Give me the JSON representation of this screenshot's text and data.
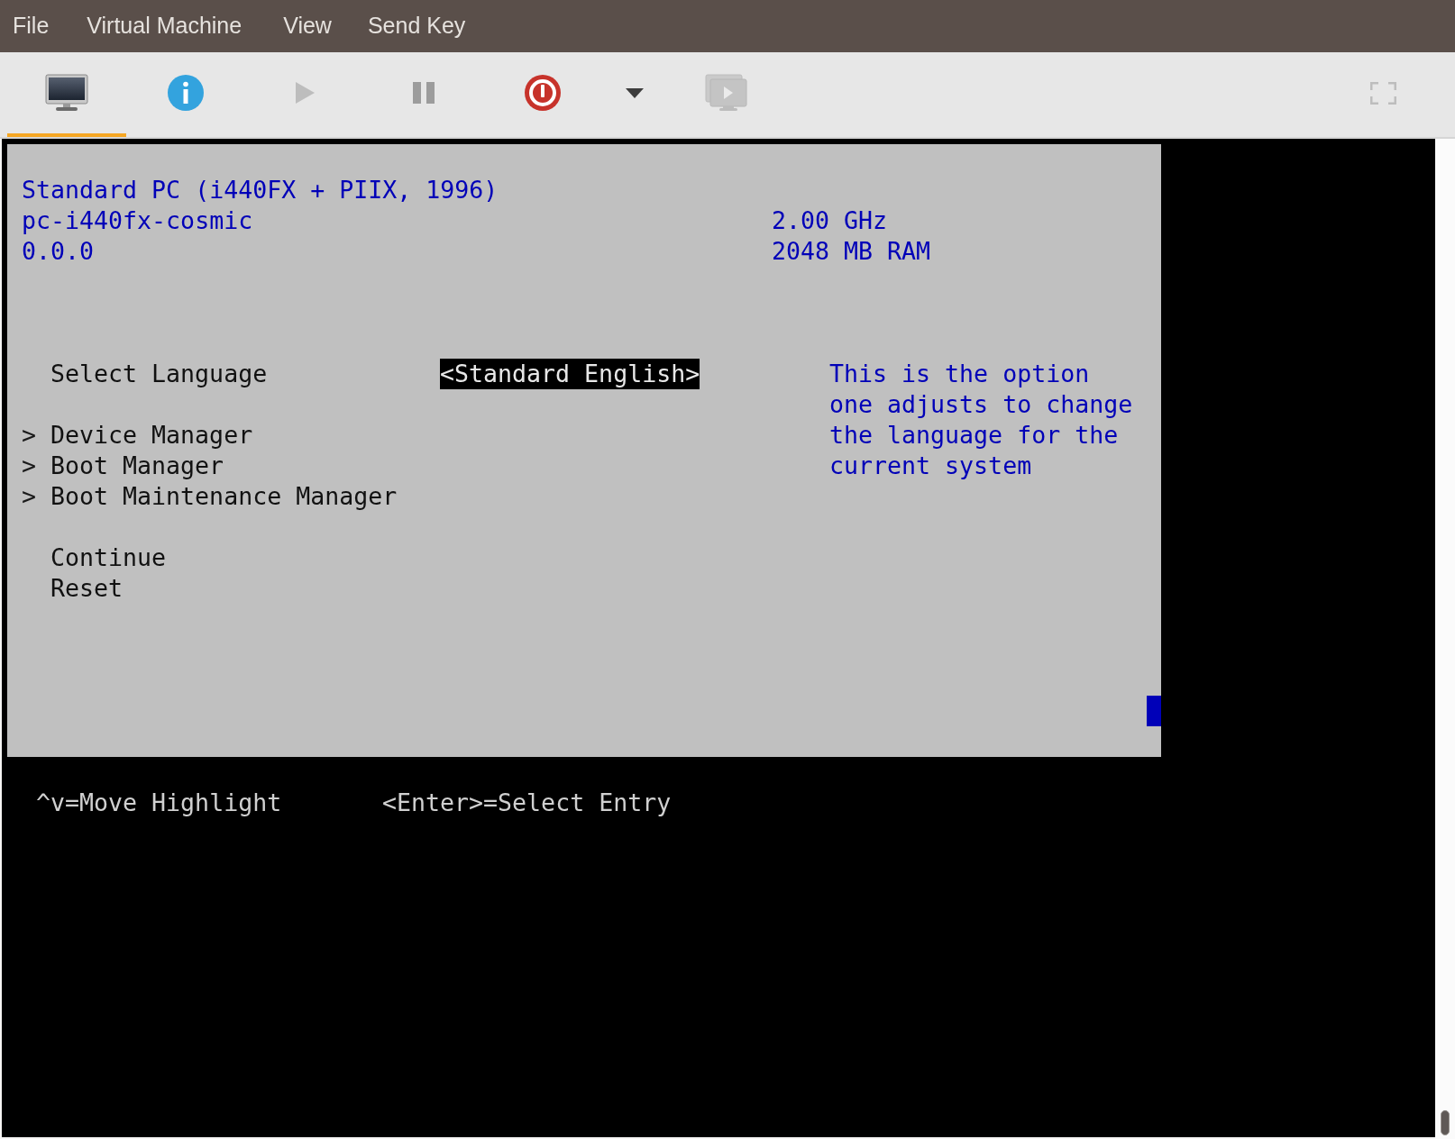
{
  "menu_bar": [
    {
      "label": "File"
    },
    {
      "label": "Virtual Machine"
    },
    {
      "label": "View"
    },
    {
      "label": "Send Key"
    }
  ],
  "toolbar": [
    {
      "kind": "console",
      "selected": true,
      "disabled": false
    },
    {
      "kind": "details",
      "selected": false,
      "disabled": false
    },
    {
      "kind": "run",
      "selected": false,
      "disabled": true
    },
    {
      "kind": "pause",
      "selected": false,
      "disabled": false
    },
    {
      "kind": "shutdown",
      "selected": false,
      "disabled": false
    },
    {
      "kind": "dropdown",
      "selected": false,
      "disabled": false
    },
    {
      "kind": "snapshots",
      "selected": false,
      "disabled": true
    },
    {
      "kind": "fullscreen",
      "selected": false,
      "disabled": true
    }
  ],
  "console": {
    "system": [
      "Standard PC (i440FX + PIIX, 1996)",
      "pc-i440fx-cosmic",
      "0.0.0"
    ],
    "specs": [
      "2.00 GHz",
      "2048 MB RAM"
    ],
    "entries": [
      {
        "kind": "option",
        "label": "Select Language",
        "value": "<Standard English>",
        "selected": true
      },
      {
        "kind": "submenu",
        "marker": ">",
        "label": "Device Manager",
        "selected": false
      },
      {
        "kind": "submenu",
        "marker": ">",
        "label": "Boot Manager",
        "selected": false
      },
      {
        "kind": "submenu",
        "marker": ">",
        "label": "Boot Maintenance Manager",
        "selected": false
      },
      {
        "kind": "action",
        "label": "Continue",
        "selected": false
      },
      {
        "kind": "action",
        "label": "Reset",
        "selected": false
      }
    ],
    "help": [
      "This is the option",
      "one adjusts to change",
      "the language for the",
      "current system"
    ],
    "footer": [
      "^v=Move Highlight",
      "<Enter>=Select Entry"
    ]
  }
}
